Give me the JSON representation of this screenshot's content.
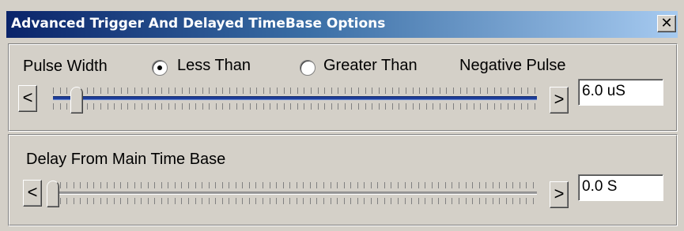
{
  "window": {
    "title": "Advanced Trigger And Delayed TimeBase Options",
    "close_glyph": "✕"
  },
  "pulse_group": {
    "label": "Pulse Width",
    "options": [
      {
        "label": "Less Than",
        "checked": true
      },
      {
        "label": "Greater Than",
        "checked": false
      }
    ],
    "polarity_label": "Negative Pulse",
    "slider": {
      "left_glyph": "<",
      "right_glyph": ">",
      "level": 0.05
    },
    "value": "6.0 uS"
  },
  "delay_group": {
    "label": "Delay From Main Time Base",
    "slider": {
      "left_glyph": "<",
      "right_glyph": ">",
      "level": 0.0
    },
    "value": "0.0  S"
  },
  "colors": {
    "titlebar_start": "#0a246a",
    "titlebar_end": "#a6caf0",
    "face": "#d4d0c8",
    "active_track": "#1f3f9a"
  }
}
